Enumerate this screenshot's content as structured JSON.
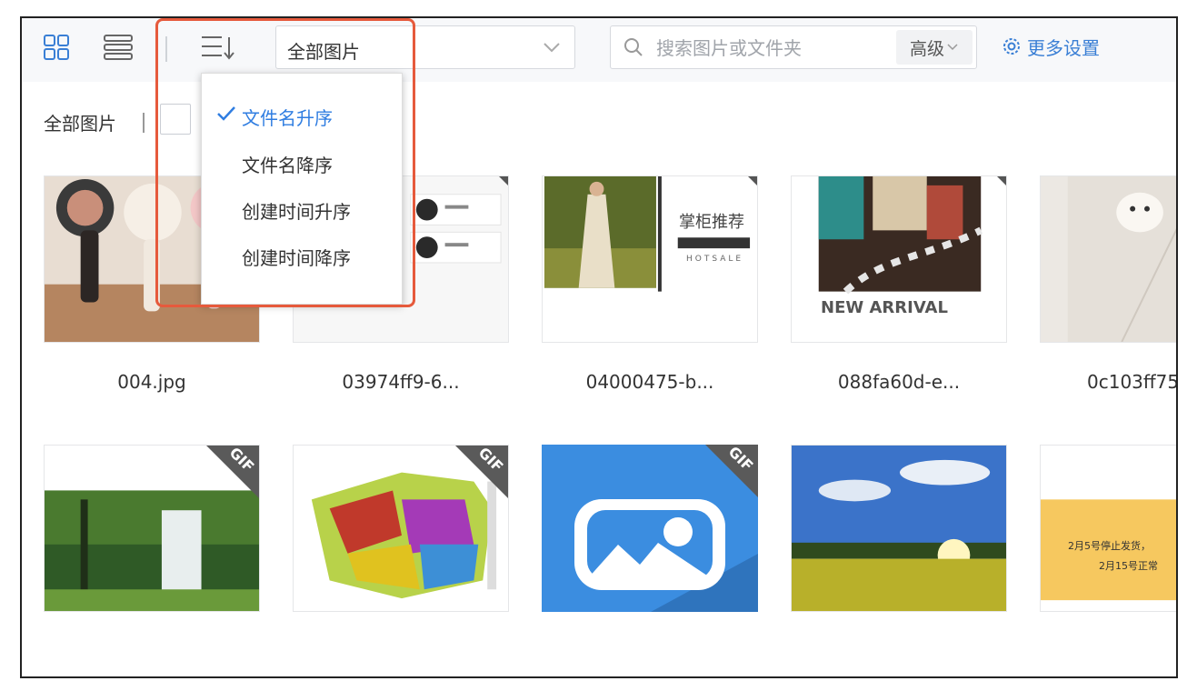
{
  "toolbar": {
    "select_value": "全部图片",
    "search_placeholder": "搜索图片或文件夹",
    "advanced_label": "高级",
    "more_settings_label": "更多设置"
  },
  "breadcrumb": "全部图片",
  "sort_menu": {
    "items": [
      {
        "label": "文件名升序",
        "active": true
      },
      {
        "label": "文件名降序",
        "active": false
      },
      {
        "label": "创建时间升序",
        "active": false
      },
      {
        "label": "创建时间降序",
        "active": false
      }
    ]
  },
  "cards": [
    {
      "label": "004.jpg",
      "thumb_text": ""
    },
    {
      "label": "03974ff9-6...",
      "thumb_text": ""
    },
    {
      "label": "04000475-b...",
      "thumb_text": "掌柜推荐",
      "thumb_sub": "HOTSALE"
    },
    {
      "label": "088fa60d-e...",
      "thumb_text": "NEW ARRIVAL"
    },
    {
      "label": "0c103ff75",
      "thumb_text": ""
    },
    {
      "label": "",
      "badge": "GIF"
    },
    {
      "label": "",
      "badge": "GIF"
    },
    {
      "label": "",
      "badge": "GIF"
    },
    {
      "label": ""
    },
    {
      "label": "",
      "notice_line1": "2月5号停止发货，",
      "notice_line2": "2月15号正常"
    }
  ],
  "colors": {
    "accent": "#3a7fd5",
    "highlight": "#e65a3c",
    "blue_tile": "#3b8de0",
    "notice_bg": "#f6c85f"
  }
}
